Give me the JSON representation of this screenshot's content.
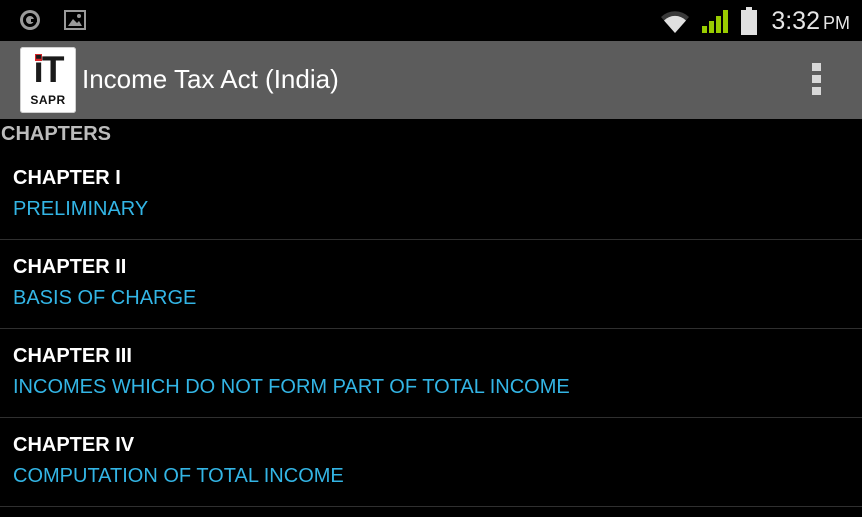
{
  "status_bar": {
    "time": "3:32",
    "ampm": "PM",
    "icons": [
      "sync-circle-icon",
      "image-icon",
      "wifi-icon",
      "signal-icon",
      "battery-icon"
    ]
  },
  "action_bar": {
    "logo_text": "iT",
    "logo_subtext": "SAPR",
    "title": "Income Tax Act (India)",
    "menu_icon": "overflow-menu-icon"
  },
  "section_header": "CHAPTERS",
  "chapters": [
    {
      "title": "CHAPTER I",
      "subtitle": "PRELIMINARY"
    },
    {
      "title": "CHAPTER II",
      "subtitle": "BASIS OF CHARGE"
    },
    {
      "title": "CHAPTER III",
      "subtitle": "INCOMES WHICH DO NOT FORM PART OF TOTAL INCOME"
    },
    {
      "title": "CHAPTER IV",
      "subtitle": "COMPUTATION OF TOTAL INCOME"
    }
  ],
  "colors": {
    "background": "#000000",
    "action_bar": "#5c5c5c",
    "accent": "#33b5e5",
    "signal_green": "#99cc00"
  }
}
